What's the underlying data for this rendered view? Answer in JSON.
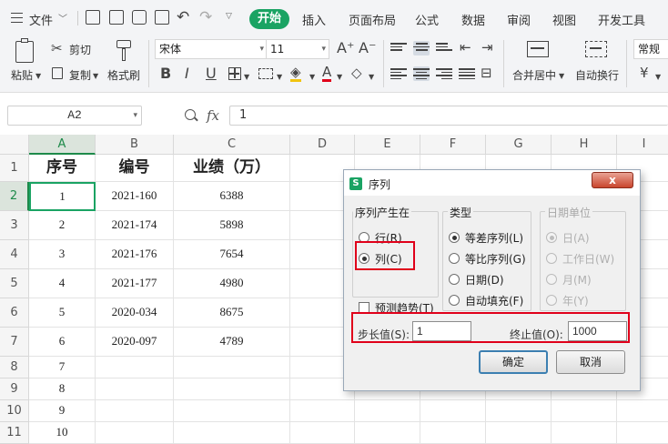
{
  "menubar": {
    "menu_label": "文件",
    "tabs": [
      "开始",
      "插入",
      "页面布局",
      "公式",
      "数据",
      "审阅",
      "视图",
      "开发工具"
    ],
    "active_tab": "开始"
  },
  "ribbon": {
    "paste": "粘贴",
    "cut": "剪切",
    "copy": "复制",
    "format_painter": "格式刷",
    "font_name": "宋体",
    "font_size": "11",
    "merge_center": "合并居中",
    "wrap_text": "自动换行",
    "number_format": "常规"
  },
  "formula_bar": {
    "cell_ref": "A2",
    "fx_label": "fx",
    "content": "1"
  },
  "sheet": {
    "columns": [
      "A",
      "B",
      "C",
      "D",
      "E",
      "F",
      "G",
      "H",
      "I"
    ],
    "rows": [
      "1",
      "2",
      "3",
      "4",
      "5",
      "6",
      "7",
      "8",
      "9",
      "10",
      "11"
    ],
    "header_row": [
      "序号",
      "编号",
      "业绩（万）"
    ],
    "data": [
      [
        "1",
        "2021-160",
        "6388"
      ],
      [
        "2",
        "2021-174",
        "5898"
      ],
      [
        "3",
        "2021-176",
        "7654"
      ],
      [
        "4",
        "2021-177",
        "4980"
      ],
      [
        "5",
        "2020-034",
        "8675"
      ],
      [
        "6",
        "2020-097",
        "4789"
      ],
      [
        "7",
        "",
        ""
      ],
      [
        "8",
        "",
        ""
      ],
      [
        "9",
        "",
        ""
      ],
      [
        "10",
        "",
        ""
      ]
    ],
    "selected_column": "A",
    "selected_row": "2"
  },
  "dialog": {
    "title": "序列",
    "close_label": "x",
    "series_in": {
      "title": "序列产生在",
      "options": [
        "行(R)",
        "列(C)"
      ],
      "selected": "列(C)"
    },
    "type": {
      "title": "类型",
      "options": [
        "等差序列(L)",
        "等比序列(G)",
        "日期(D)",
        "自动填充(F)"
      ],
      "selected": "等差序列(L)"
    },
    "date_unit": {
      "title": "日期单位",
      "options": [
        "日(A)",
        "工作日(W)",
        "月(M)",
        "年(Y)"
      ],
      "selected": "日(A)",
      "disabled": true
    },
    "trend_label": "预测趋势(T)",
    "step_label": "步长值(S):",
    "step_value": "1",
    "stop_label": "终止值(O):",
    "stop_value": "1000",
    "ok": "确定",
    "cancel": "取消"
  },
  "colors": {
    "accent": "#1aa363",
    "highlight_box": "#e0001a"
  }
}
